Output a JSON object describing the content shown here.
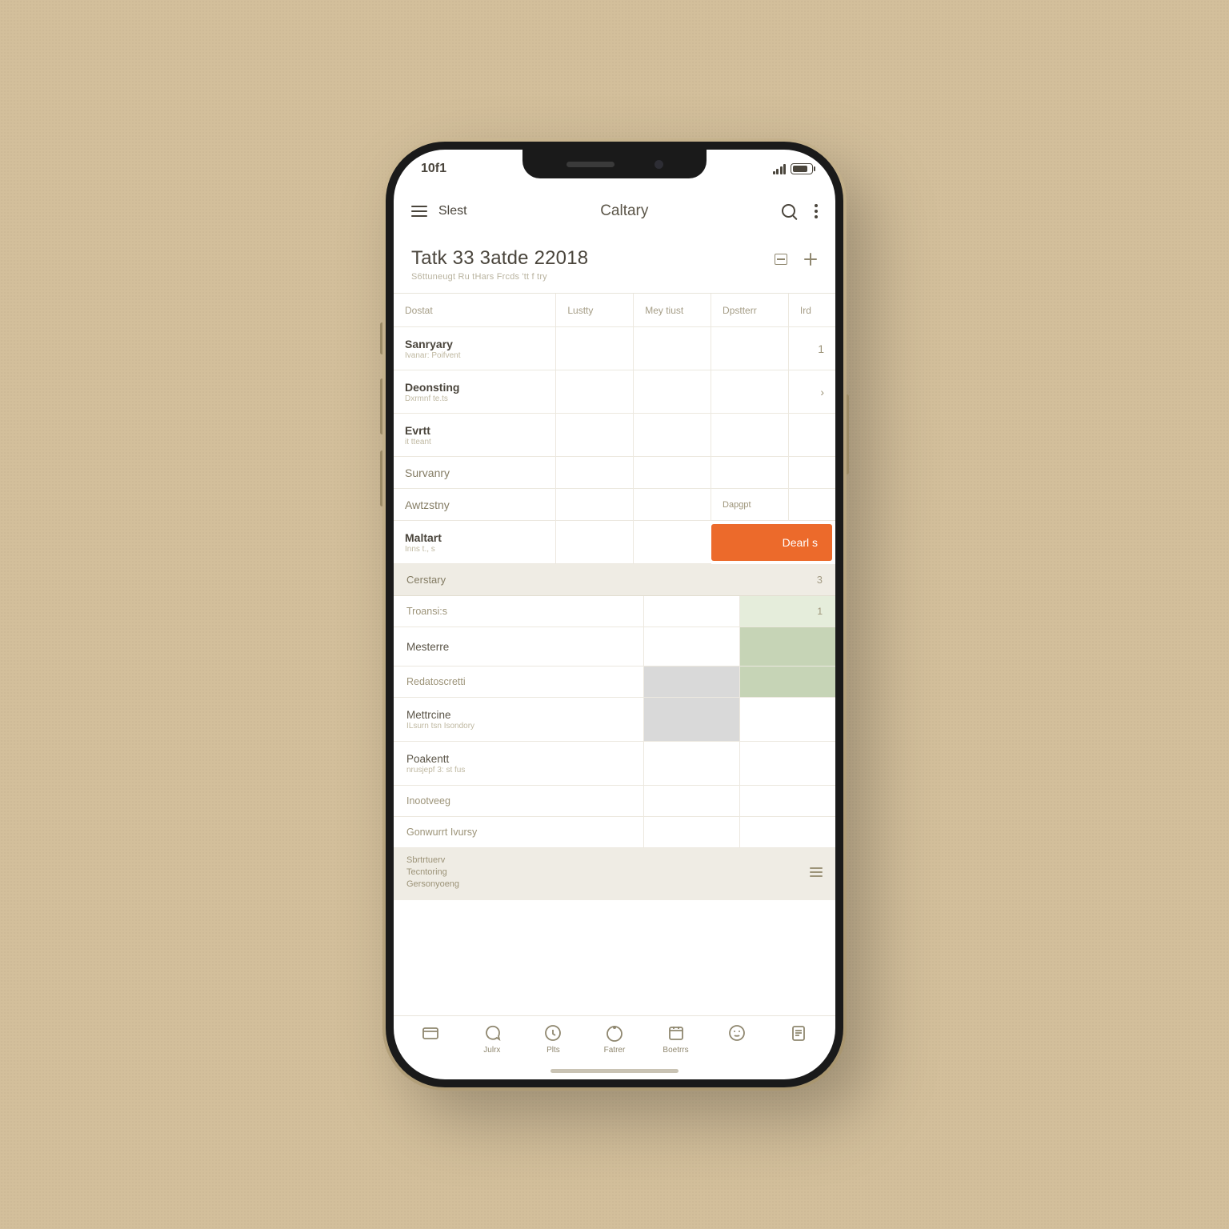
{
  "status": {
    "time": "10f1"
  },
  "appbar": {
    "left_label": "Slest",
    "title": "Caltary"
  },
  "page_header": {
    "title": "Tatk 33 3atde 22018",
    "subtitle": "S6ttuneugt Ru tHars Frcds 'tt f try"
  },
  "table1": {
    "columns": [
      "Dostat",
      "Lustty",
      "Mey tiust",
      "Dpstterr",
      "Ird"
    ],
    "rows": [
      {
        "title": "Sanryary",
        "sub": "Ivanar: Poifvent",
        "trail": "1"
      },
      {
        "title": "Deonsting",
        "sub": "Dxrmnf te.ts"
      },
      {
        "title": "Evrtt",
        "sub": "it tteant"
      },
      {
        "title": "Survanry",
        "light": true
      },
      {
        "title": "Awtzstny",
        "light": true,
        "tag": "Dapgpt"
      },
      {
        "title": "Maltart",
        "sub": "Inns t., s",
        "button": "Dearl s"
      }
    ]
  },
  "section": {
    "title": "Cerstary",
    "count": "3"
  },
  "table2": {
    "rows": [
      {
        "title": "Troansi:s",
        "muted": true,
        "c2": "ltgreen",
        "trail": "1"
      },
      {
        "title": "Mesterre",
        "c2": "green"
      },
      {
        "title": "Redatoscretti",
        "muted": true,
        "c2": "green",
        "c1": "grey"
      },
      {
        "title": "Mettrcine",
        "sub": "ILsurn tsn Isondory",
        "c1": "grey"
      },
      {
        "title": "Poakentt",
        "sub": "nrusjepf 3: st fus"
      },
      {
        "title": "Inootveeg",
        "muted": true
      },
      {
        "title": "Gonwurrt Ivursy",
        "muted": true
      }
    ]
  },
  "footer_note": {
    "l1": "Sbrtrtuerv",
    "l2": "Tecntoring",
    "l3": "Gersonyoeng"
  },
  "nav": [
    {
      "label": ""
    },
    {
      "label": "Julrx"
    },
    {
      "label": "Plts"
    },
    {
      "label": "Fatrer"
    },
    {
      "label": "Boetrrs"
    },
    {
      "label": ""
    },
    {
      "label": ""
    }
  ]
}
